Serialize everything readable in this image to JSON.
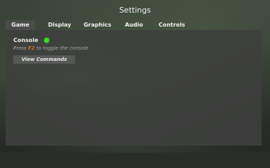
{
  "window": {
    "title": "Settings"
  },
  "tabs": [
    {
      "label": "Game",
      "active": true
    },
    {
      "label": "Display",
      "active": false
    },
    {
      "label": "Graphics",
      "active": false
    },
    {
      "label": "Audio",
      "active": false
    },
    {
      "label": "Controls",
      "active": false
    }
  ],
  "game": {
    "console": {
      "label": "Console",
      "enabled": true,
      "indicator_color": "#39e21a"
    },
    "hint": {
      "prefix": "Press ",
      "key": "F2",
      "suffix": " to toggle the console",
      "key_color": "#e0701c"
    },
    "view_commands_label": "View Commands"
  }
}
